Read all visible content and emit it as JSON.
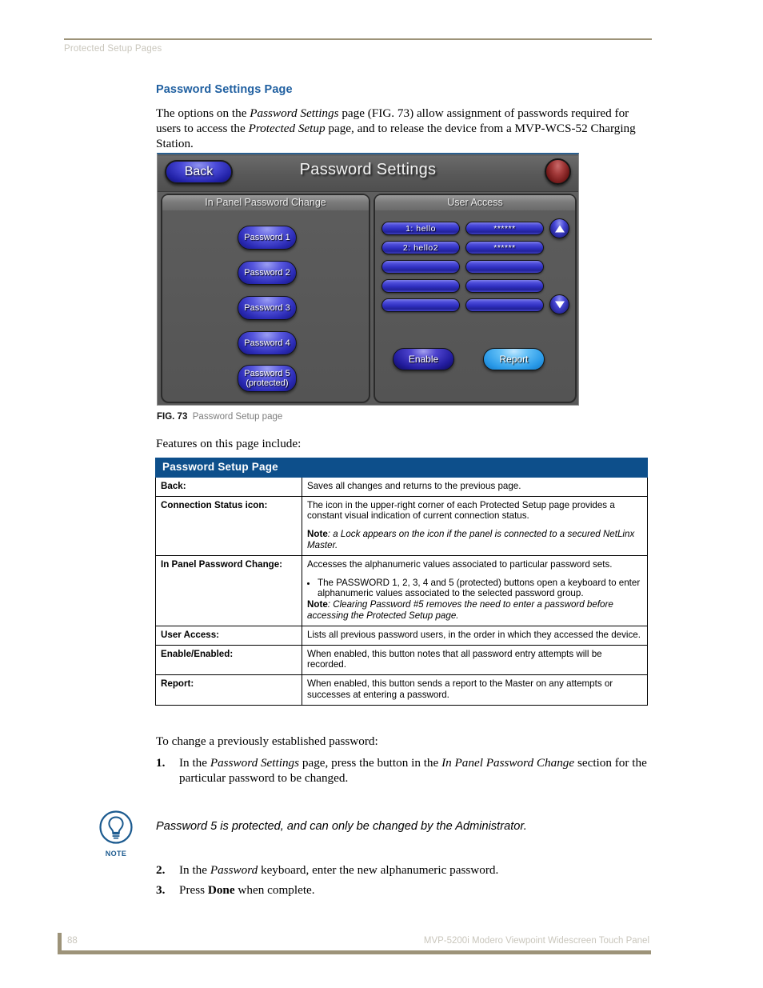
{
  "header": {
    "running_head": "Protected Setup Pages"
  },
  "section": {
    "title": "Password Settings Page",
    "intro_part1": "The options on the ",
    "intro_em1": "Password Settings",
    "intro_part2": " page (FIG. 73) allow assignment of passwords required for users to access the ",
    "intro_em2": "Protected Setup",
    "intro_part3": " page, and to release the device from a MVP-WCS-52 Charging Station."
  },
  "touch_panel": {
    "back_label": "Back",
    "title": "Password Settings",
    "status_icon": "connection-status-indicator",
    "status_color": "#8f2020",
    "left_pane_header": "In Panel Password Change",
    "right_pane_header": "User Access",
    "password_buttons": [
      {
        "line1": "Password 1",
        "line2": ""
      },
      {
        "line1": "Password 2",
        "line2": ""
      },
      {
        "line1": "Password 3",
        "line2": ""
      },
      {
        "line1": "Password 4",
        "line2": ""
      },
      {
        "line1": "Password 5",
        "line2": "(protected)"
      }
    ],
    "user_access_rows": [
      {
        "name": "1:  hello",
        "password": "******"
      },
      {
        "name": "2:  hello2",
        "password": "******"
      },
      {
        "name": "",
        "password": ""
      },
      {
        "name": "",
        "password": ""
      },
      {
        "name": "",
        "password": ""
      }
    ],
    "scroll_up_icon": "arrow-up-icon",
    "scroll_down_icon": "arrow-down-icon",
    "enable_label": "Enable",
    "report_label": "Report",
    "enable_color": "#2222a8",
    "report_color": "#3aa6ea"
  },
  "figure": {
    "number": "FIG. 73",
    "caption": "Password Setup page"
  },
  "lead_in": "Features on this page include:",
  "table": {
    "header": "Password Setup Page",
    "rows": [
      {
        "label": "Back:",
        "paragraphs": [
          {
            "type": "plain",
            "text": "Saves all changes and returns to the previous page."
          }
        ]
      },
      {
        "label": "Connection Status icon:",
        "paragraphs": [
          {
            "type": "plain",
            "text": "The icon in the upper-right corner of each Protected Setup page provides a constant visual indication of current connection status."
          },
          {
            "type": "note",
            "prefix": "Note",
            "text": ": a Lock appears on the icon if the panel is connected to a secured NetLinx Master."
          }
        ]
      },
      {
        "label": "In Panel Password Change:",
        "paragraphs": [
          {
            "type": "plain",
            "text": "Accesses the alphanumeric values associated to particular password sets."
          },
          {
            "type": "bullet",
            "text": "The PASSWORD 1, 2, 3, 4 and 5 (protected) buttons open a keyboard to enter alphanumeric values associated to the selected password group."
          },
          {
            "type": "note",
            "prefix": "Note",
            "text": ": Clearing Password #5 removes the need to enter a password before accessing the Protected Setup page."
          }
        ]
      },
      {
        "label": "User Access:",
        "paragraphs": [
          {
            "type": "plain",
            "text": "Lists all previous password users, in the order in which they accessed the device."
          }
        ]
      },
      {
        "label": "Enable/Enabled:",
        "paragraphs": [
          {
            "type": "plain",
            "text": "When enabled, this button notes that all password entry attempts will be recorded."
          }
        ]
      },
      {
        "label": "Report:",
        "paragraphs": [
          {
            "type": "plain",
            "text": "When enabled, this button sends a report to the Master on any attempts or successes at entering a password."
          }
        ]
      }
    ]
  },
  "procedure": {
    "intro": "To change a previously established password:",
    "steps": [
      {
        "num": "1.",
        "frag": [
          {
            "style": "plain",
            "text": "In the "
          },
          {
            "style": "italic",
            "text": "Password Settings"
          },
          {
            "style": "plain",
            "text": " page, press the button in the "
          },
          {
            "style": "italic",
            "text": "In Panel Password Change"
          },
          {
            "style": "plain",
            "text": " section for the particular password to be changed."
          }
        ]
      },
      {
        "num": "2.",
        "frag": [
          {
            "style": "plain",
            "text": "In the "
          },
          {
            "style": "italic",
            "text": "Password"
          },
          {
            "style": "plain",
            "text": " keyboard, enter the new alphanumeric password."
          }
        ]
      },
      {
        "num": "3.",
        "frag": [
          {
            "style": "plain",
            "text": "Press "
          },
          {
            "style": "bold",
            "text": "Done"
          },
          {
            "style": "plain",
            "text": " when complete."
          }
        ]
      }
    ]
  },
  "note_callout": {
    "icon_label": "NOTE",
    "text": "Password 5 is protected, and can only be changed by the Administrator."
  },
  "footer": {
    "page_number": "88",
    "doc_title": "MVP-5200i Modero Viewpoint Widescreen Touch Panel"
  }
}
